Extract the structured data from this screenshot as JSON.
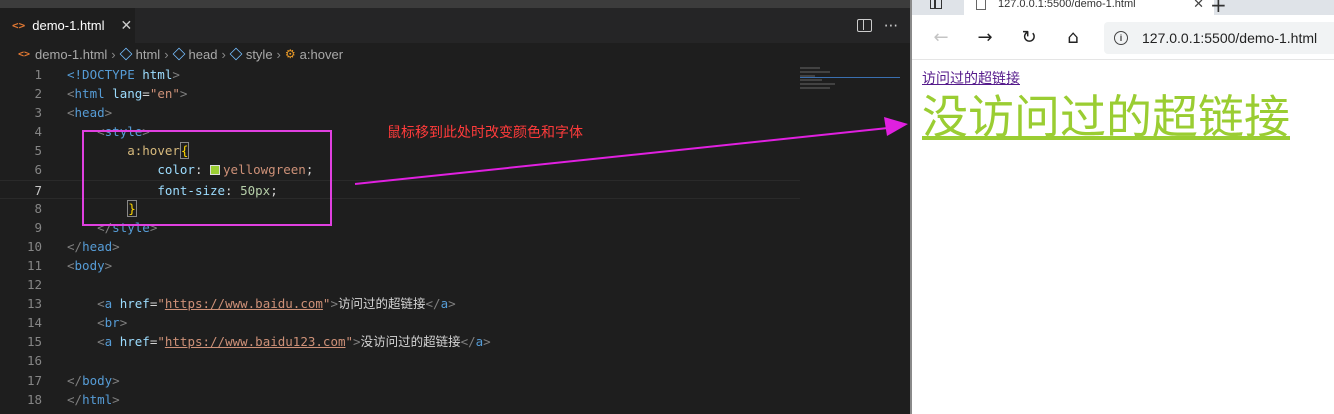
{
  "editor": {
    "tab": {
      "icon": "<>",
      "label": "demo-1.html",
      "close": "✕"
    },
    "breadcrumb": [
      {
        "label": "demo-1.html",
        "icon": "html-file-icon"
      },
      {
        "label": "html",
        "icon": "element-icon"
      },
      {
        "label": "head",
        "icon": "element-icon"
      },
      {
        "label": "style",
        "icon": "element-icon"
      },
      {
        "label": "a:hover",
        "icon": "selector-icon"
      }
    ],
    "line_numbers": [
      "1",
      "2",
      "3",
      "4",
      "5",
      "6",
      "7",
      "8",
      "9",
      "10",
      "11",
      "12",
      "13",
      "14",
      "15",
      "16",
      "17",
      "18"
    ],
    "current_line": "7",
    "code": {
      "l1_doctype": "<!DOCTYPE",
      "l1_html": " html",
      "l1_close": ">",
      "l2_open": "<",
      "l2_tag": "html",
      "l2_attr": " lang",
      "l2_eq": "=",
      "l2_val": "\"en\"",
      "l2_close": ">",
      "l3": "head",
      "l4": "style",
      "l5_sel": "a:hover",
      "l5_brace": "{",
      "l6_prop": "color",
      "l6_val": "yellowgreen",
      "l7_prop": "font-size",
      "l7_val": "50px",
      "l8_brace": "}",
      "l9": "style",
      "l10": "head",
      "l11": "body",
      "l13_attr": "href",
      "l13_url": "https://www.baidu.com",
      "l13_text": "访问过的超链接",
      "l14": "br",
      "l15_url": "https://www.baidu123.com",
      "l15_text": "没访问过的超链接",
      "l17": "body",
      "l18": "html"
    },
    "annotation": "鼠标移到此处时改变颜色和字体",
    "colors": {
      "highlight": "#e040e0",
      "annotation": "#ff3b3b",
      "swatch": "#9acd32"
    }
  },
  "browser": {
    "tab_title": "127.0.0.1:5500/demo-1.html",
    "tab_close": "✕",
    "new_tab": "+",
    "back": "←",
    "forward": "→",
    "reload": "↻",
    "home": "⌂",
    "info": "i",
    "url": "127.0.0.1:5500/demo-1.html",
    "links": {
      "visited": "访问过的超链接",
      "hovered": "没访问过的超链接"
    },
    "colors": {
      "visited": "#551a8b",
      "hovered": "#9acd32"
    }
  }
}
